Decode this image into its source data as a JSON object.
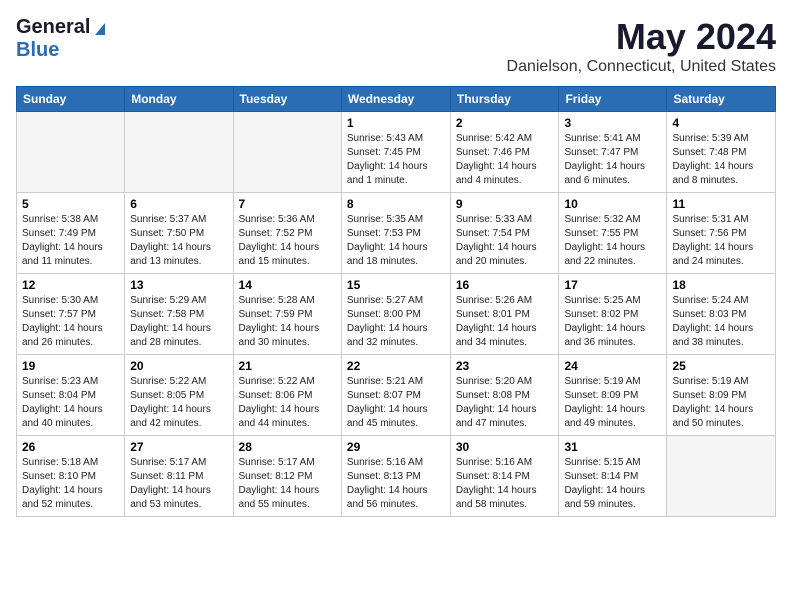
{
  "header": {
    "logo_general": "General",
    "logo_blue": "Blue",
    "month_year": "May 2024",
    "location": "Danielson, Connecticut, United States"
  },
  "days_of_week": [
    "Sunday",
    "Monday",
    "Tuesday",
    "Wednesday",
    "Thursday",
    "Friday",
    "Saturday"
  ],
  "weeks": [
    [
      {
        "day": "",
        "info": ""
      },
      {
        "day": "",
        "info": ""
      },
      {
        "day": "",
        "info": ""
      },
      {
        "day": "1",
        "info": "Sunrise: 5:43 AM\nSunset: 7:45 PM\nDaylight: 14 hours\nand 1 minute."
      },
      {
        "day": "2",
        "info": "Sunrise: 5:42 AM\nSunset: 7:46 PM\nDaylight: 14 hours\nand 4 minutes."
      },
      {
        "day": "3",
        "info": "Sunrise: 5:41 AM\nSunset: 7:47 PM\nDaylight: 14 hours\nand 6 minutes."
      },
      {
        "day": "4",
        "info": "Sunrise: 5:39 AM\nSunset: 7:48 PM\nDaylight: 14 hours\nand 8 minutes."
      }
    ],
    [
      {
        "day": "5",
        "info": "Sunrise: 5:38 AM\nSunset: 7:49 PM\nDaylight: 14 hours\nand 11 minutes."
      },
      {
        "day": "6",
        "info": "Sunrise: 5:37 AM\nSunset: 7:50 PM\nDaylight: 14 hours\nand 13 minutes."
      },
      {
        "day": "7",
        "info": "Sunrise: 5:36 AM\nSunset: 7:52 PM\nDaylight: 14 hours\nand 15 minutes."
      },
      {
        "day": "8",
        "info": "Sunrise: 5:35 AM\nSunset: 7:53 PM\nDaylight: 14 hours\nand 18 minutes."
      },
      {
        "day": "9",
        "info": "Sunrise: 5:33 AM\nSunset: 7:54 PM\nDaylight: 14 hours\nand 20 minutes."
      },
      {
        "day": "10",
        "info": "Sunrise: 5:32 AM\nSunset: 7:55 PM\nDaylight: 14 hours\nand 22 minutes."
      },
      {
        "day": "11",
        "info": "Sunrise: 5:31 AM\nSunset: 7:56 PM\nDaylight: 14 hours\nand 24 minutes."
      }
    ],
    [
      {
        "day": "12",
        "info": "Sunrise: 5:30 AM\nSunset: 7:57 PM\nDaylight: 14 hours\nand 26 minutes."
      },
      {
        "day": "13",
        "info": "Sunrise: 5:29 AM\nSunset: 7:58 PM\nDaylight: 14 hours\nand 28 minutes."
      },
      {
        "day": "14",
        "info": "Sunrise: 5:28 AM\nSunset: 7:59 PM\nDaylight: 14 hours\nand 30 minutes."
      },
      {
        "day": "15",
        "info": "Sunrise: 5:27 AM\nSunset: 8:00 PM\nDaylight: 14 hours\nand 32 minutes."
      },
      {
        "day": "16",
        "info": "Sunrise: 5:26 AM\nSunset: 8:01 PM\nDaylight: 14 hours\nand 34 minutes."
      },
      {
        "day": "17",
        "info": "Sunrise: 5:25 AM\nSunset: 8:02 PM\nDaylight: 14 hours\nand 36 minutes."
      },
      {
        "day": "18",
        "info": "Sunrise: 5:24 AM\nSunset: 8:03 PM\nDaylight: 14 hours\nand 38 minutes."
      }
    ],
    [
      {
        "day": "19",
        "info": "Sunrise: 5:23 AM\nSunset: 8:04 PM\nDaylight: 14 hours\nand 40 minutes."
      },
      {
        "day": "20",
        "info": "Sunrise: 5:22 AM\nSunset: 8:05 PM\nDaylight: 14 hours\nand 42 minutes."
      },
      {
        "day": "21",
        "info": "Sunrise: 5:22 AM\nSunset: 8:06 PM\nDaylight: 14 hours\nand 44 minutes."
      },
      {
        "day": "22",
        "info": "Sunrise: 5:21 AM\nSunset: 8:07 PM\nDaylight: 14 hours\nand 45 minutes."
      },
      {
        "day": "23",
        "info": "Sunrise: 5:20 AM\nSunset: 8:08 PM\nDaylight: 14 hours\nand 47 minutes."
      },
      {
        "day": "24",
        "info": "Sunrise: 5:19 AM\nSunset: 8:09 PM\nDaylight: 14 hours\nand 49 minutes."
      },
      {
        "day": "25",
        "info": "Sunrise: 5:19 AM\nSunset: 8:09 PM\nDaylight: 14 hours\nand 50 minutes."
      }
    ],
    [
      {
        "day": "26",
        "info": "Sunrise: 5:18 AM\nSunset: 8:10 PM\nDaylight: 14 hours\nand 52 minutes."
      },
      {
        "day": "27",
        "info": "Sunrise: 5:17 AM\nSunset: 8:11 PM\nDaylight: 14 hours\nand 53 minutes."
      },
      {
        "day": "28",
        "info": "Sunrise: 5:17 AM\nSunset: 8:12 PM\nDaylight: 14 hours\nand 55 minutes."
      },
      {
        "day": "29",
        "info": "Sunrise: 5:16 AM\nSunset: 8:13 PM\nDaylight: 14 hours\nand 56 minutes."
      },
      {
        "day": "30",
        "info": "Sunrise: 5:16 AM\nSunset: 8:14 PM\nDaylight: 14 hours\nand 58 minutes."
      },
      {
        "day": "31",
        "info": "Sunrise: 5:15 AM\nSunset: 8:14 PM\nDaylight: 14 hours\nand 59 minutes."
      },
      {
        "day": "",
        "info": ""
      }
    ]
  ]
}
